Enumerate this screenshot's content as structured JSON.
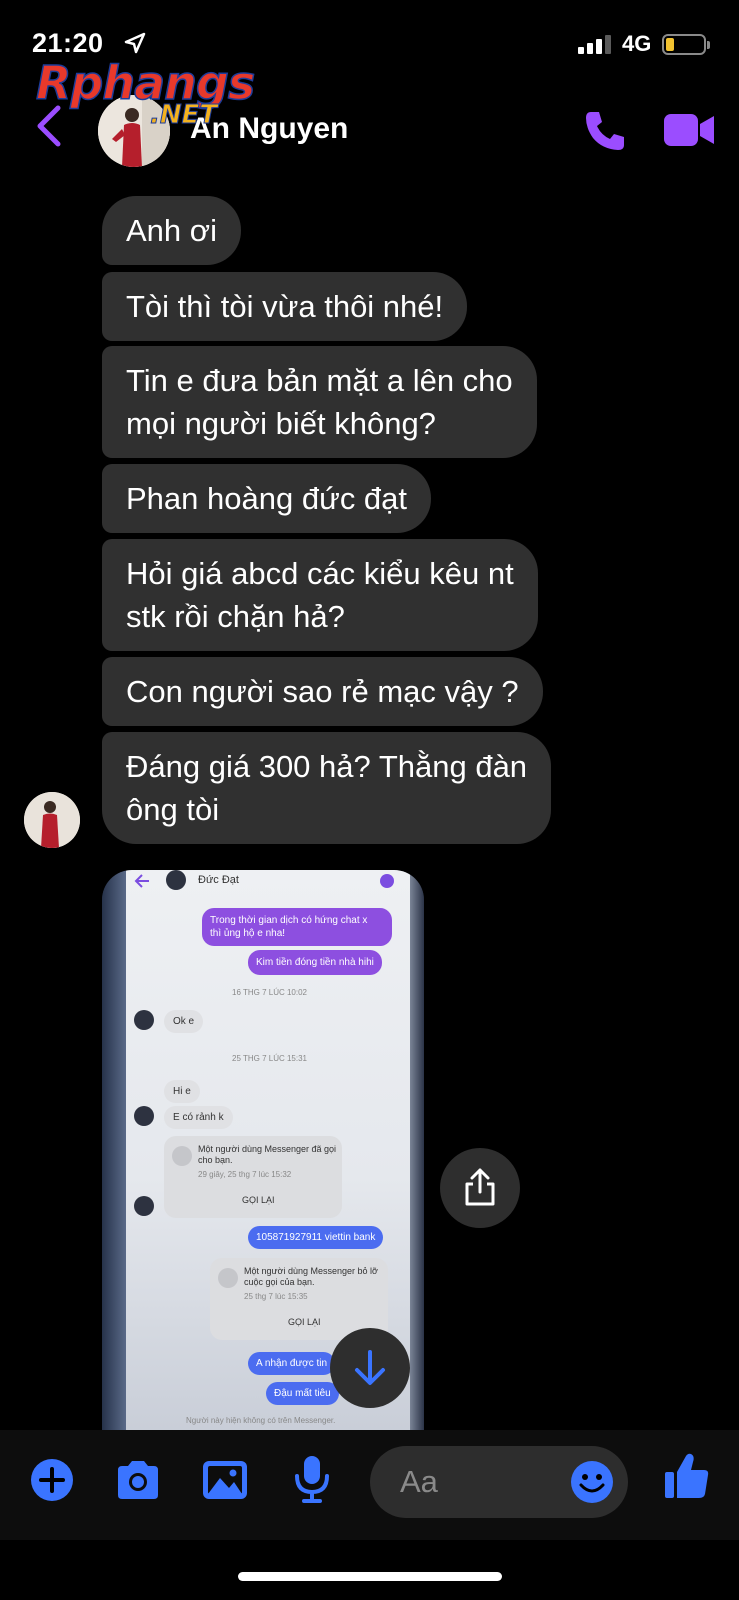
{
  "status_bar": {
    "time": "21:20",
    "network": "4G"
  },
  "watermark": {
    "main": "Rphangs",
    "sub": ".NET"
  },
  "header": {
    "contact_name": "An Nguyen"
  },
  "messages": [
    "Anh ơi",
    "Tòi thì tòi vừa thôi nhé!",
    "Tin e đưa bản mặt a lên cho\nmọi người biết không?",
    "Phan hoàng đức đạt",
    "Hỏi giá abcd các kiểu kêu nt\nstk rồi chặn hả?",
    "Con người sao rẻ mạc vậy ?",
    "Đáng giá 300 hả? Thằng đàn\nông tòi"
  ],
  "photo": {
    "contact": "Đức Đạt",
    "msg1": "Trong thời gian dịch có hứng chat x\nthì ủng hộ e nha!",
    "msg2": "Kim tiền đóng tiền nhà hihi",
    "ts1": "16 THG 7 LÚC 10:02",
    "reply1": "Ok e",
    "ts2": "25 THG 7 LÚC 15:31",
    "reply2": "Hi e",
    "reply3": "E có rảnh k",
    "call1": "Một người dùng Messenger đã gọi\ncho bạn.",
    "call1_time": "29 giây, 25 thg 7 lúc 15:32",
    "call_back": "GỌI LẠI",
    "bank": "105871927911 viettin bank",
    "call2": "Một người dùng Messenger bỏ lỡ\ncuộc gọi của bạn.",
    "call2_time": "25 thg 7 lúc 15:35",
    "call_back2": "GỌI LẠI",
    "msg3": "A nhận được tin",
    "msg4": "Đậu mất tiêu",
    "footer": "Người này hiện không có trên Messenger."
  },
  "composer": {
    "placeholder": "Aa"
  },
  "colors": {
    "accent": "#9b4dff",
    "blue": "#3a74ff",
    "bubble": "#303030"
  },
  "icons": [
    "location-arrow-icon",
    "signal-icon",
    "battery-icon",
    "back-chevron-icon",
    "phone-icon",
    "video-camera-icon",
    "share-icon",
    "arrow-down-icon",
    "plus-icon",
    "camera-icon",
    "image-icon",
    "microphone-icon",
    "emoji-icon",
    "thumbs-up-icon"
  ]
}
